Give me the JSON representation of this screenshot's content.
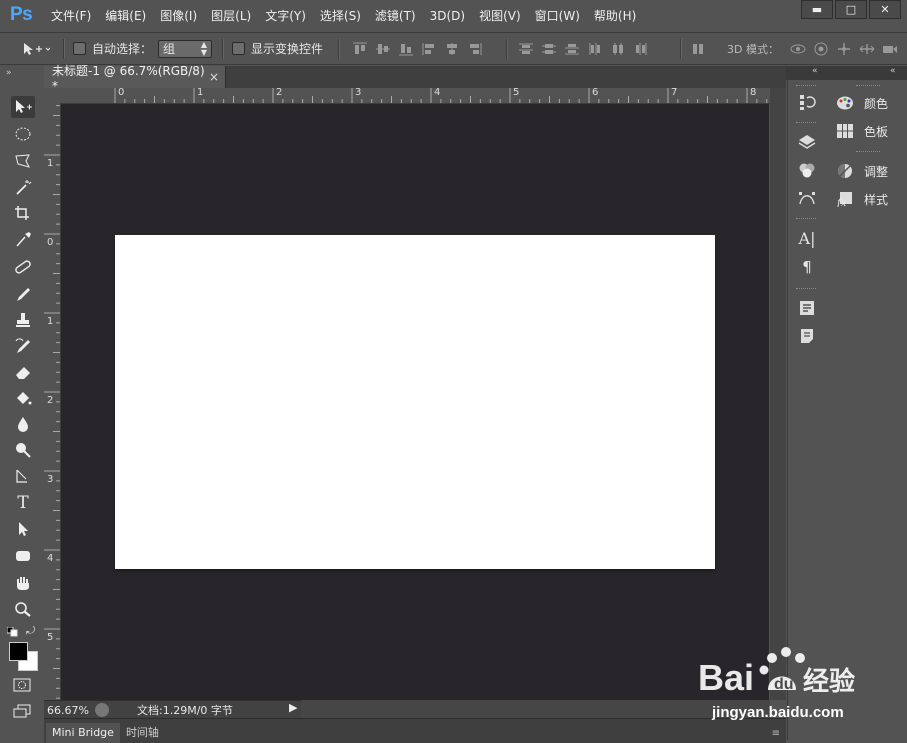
{
  "app": {
    "logo": "Ps"
  },
  "menu": {
    "items": [
      "文件(F)",
      "编辑(E)",
      "图像(I)",
      "图层(L)",
      "文字(Y)",
      "选择(S)",
      "滤镜(T)",
      "3D(D)",
      "视图(V)",
      "窗口(W)",
      "帮助(H)"
    ]
  },
  "window_controls": {
    "minimize": "▬",
    "maximize": "□",
    "close": "✕"
  },
  "options_bar": {
    "auto_select_label": "自动选择：",
    "group_value": "组",
    "show_transform_label": "显示变换控件",
    "mode_3d_label": "3D 模式："
  },
  "document_tab": {
    "title": "未标题-1 @ 66.7%(RGB/8) *",
    "close": "×"
  },
  "ruler_top": {
    "numbers": [
      "0",
      "1",
      "2",
      "3",
      "4",
      "5",
      "6",
      "7",
      "8"
    ]
  },
  "ruler_left": {
    "numbers": [
      "1",
      "0",
      "1",
      "2",
      "3",
      "4",
      "5"
    ]
  },
  "status": {
    "zoom": "66.67%",
    "doc_info": "文档:1.29M/0 字节"
  },
  "bottom_tabs": [
    "Mini Bridge",
    "时间轴"
  ],
  "panels": {
    "color": "颜色",
    "swatches": "色板",
    "adjustments": "调整",
    "styles": "样式"
  },
  "watermark": {
    "text": "jingyan.baidu.com",
    "brand": "经验"
  },
  "colors": {
    "ui_bg": "#535353",
    "canvas_bg": "#28262a",
    "document": "#ffffff",
    "ps_blue": "#4ea7ff",
    "foreground": "#000000",
    "background": "#ffffff"
  },
  "icons": [
    "move-tool-icon",
    "marquee-icon",
    "lasso-icon",
    "magic-wand-icon",
    "crop-icon",
    "eyedropper-icon",
    "healing-brush-icon",
    "brush-icon",
    "clone-stamp-icon",
    "history-brush-icon",
    "eraser-icon",
    "paint-bucket-icon",
    "blur-icon",
    "dodge-icon",
    "pen-icon",
    "type-icon",
    "path-select-icon",
    "shape-icon",
    "hand-icon",
    "zoom-icon"
  ]
}
